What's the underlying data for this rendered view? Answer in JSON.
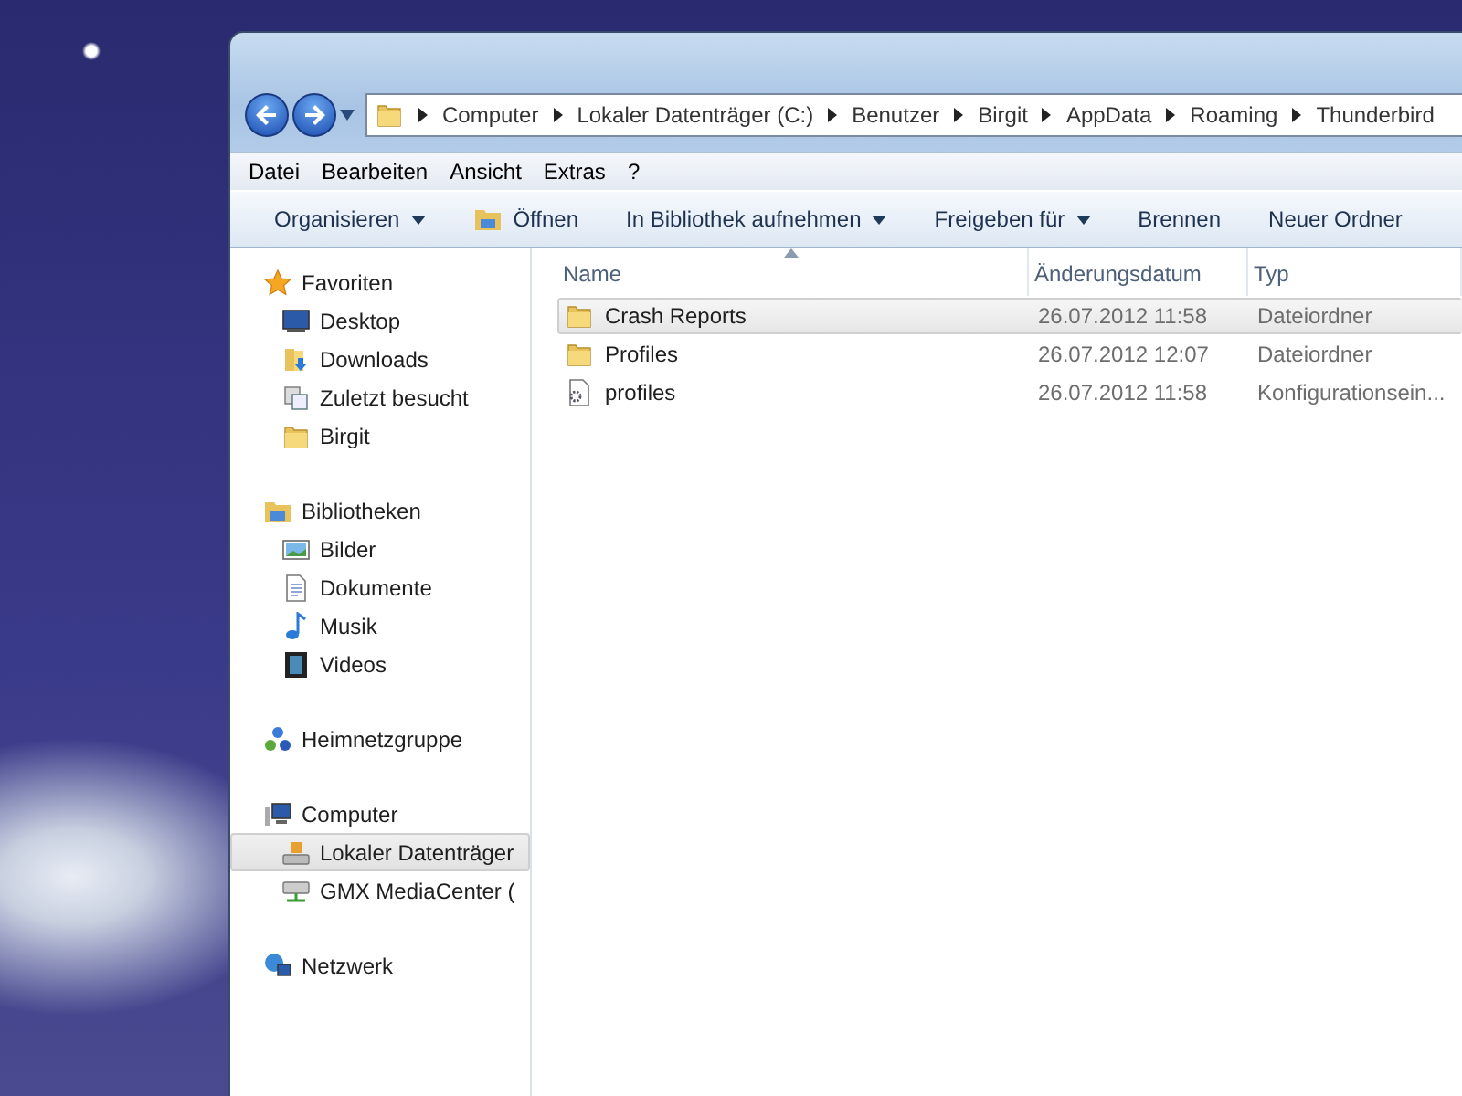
{
  "address_bar": {
    "crumbs": [
      "Computer",
      "Lokaler Datenträger (C:)",
      "Benutzer",
      "Birgit",
      "AppData",
      "Roaming",
      "Thunderbird"
    ]
  },
  "menu_bar": [
    "Datei",
    "Bearbeiten",
    "Ansicht",
    "Extras",
    "?"
  ],
  "toolbar": [
    {
      "label": "Organisieren",
      "kind": "dropdown"
    },
    {
      "label": "Öffnen",
      "kind": "open"
    },
    {
      "label": "In Bibliothek aufnehmen",
      "kind": "dropdown"
    },
    {
      "label": "Freigeben für",
      "kind": "dropdown"
    },
    {
      "label": "Brennen",
      "kind": "plain"
    },
    {
      "label": "Neuer Ordner",
      "kind": "plain"
    }
  ],
  "sidebar": {
    "groups": [
      {
        "label": "Favoriten",
        "kind": "star",
        "children": [
          {
            "label": "Desktop",
            "kind": "desktop",
            "selected": false
          },
          {
            "label": "Downloads",
            "kind": "download",
            "selected": false
          },
          {
            "label": "Zuletzt besucht",
            "kind": "recent",
            "selected": false
          },
          {
            "label": "Birgit",
            "kind": "folder",
            "selected": false
          }
        ]
      },
      {
        "label": "Bibliotheken",
        "kind": "library",
        "children": [
          {
            "label": "Bilder",
            "kind": "pictures",
            "selected": false
          },
          {
            "label": "Dokumente",
            "kind": "document",
            "selected": false
          },
          {
            "label": "Musik",
            "kind": "music",
            "selected": false
          },
          {
            "label": "Videos",
            "kind": "video",
            "selected": false
          }
        ]
      },
      {
        "label": "Heimnetzgruppe",
        "kind": "homegroup"
      },
      {
        "label": "Computer",
        "kind": "computer",
        "children": [
          {
            "label": "Lokaler Datenträger",
            "kind": "drive",
            "selected": true
          },
          {
            "label": "GMX MediaCenter (",
            "kind": "netdrive",
            "selected": false
          }
        ]
      },
      {
        "label": "Netzwerk",
        "kind": "network"
      }
    ]
  },
  "file_list": {
    "columns": [
      "Name",
      "Änderungsdatum",
      "Typ"
    ],
    "rows": [
      {
        "name": "Crash Reports",
        "date": "26.07.2012 11:58",
        "type": "Dateiordner",
        "kind": "folder",
        "selected": true
      },
      {
        "name": "Profiles",
        "date": "26.07.2012 12:07",
        "type": "Dateiordner",
        "kind": "folder",
        "selected": false
      },
      {
        "name": "profiles",
        "date": "26.07.2012 11:58",
        "type": "Konfigurationsein...",
        "kind": "config",
        "selected": false
      }
    ]
  }
}
